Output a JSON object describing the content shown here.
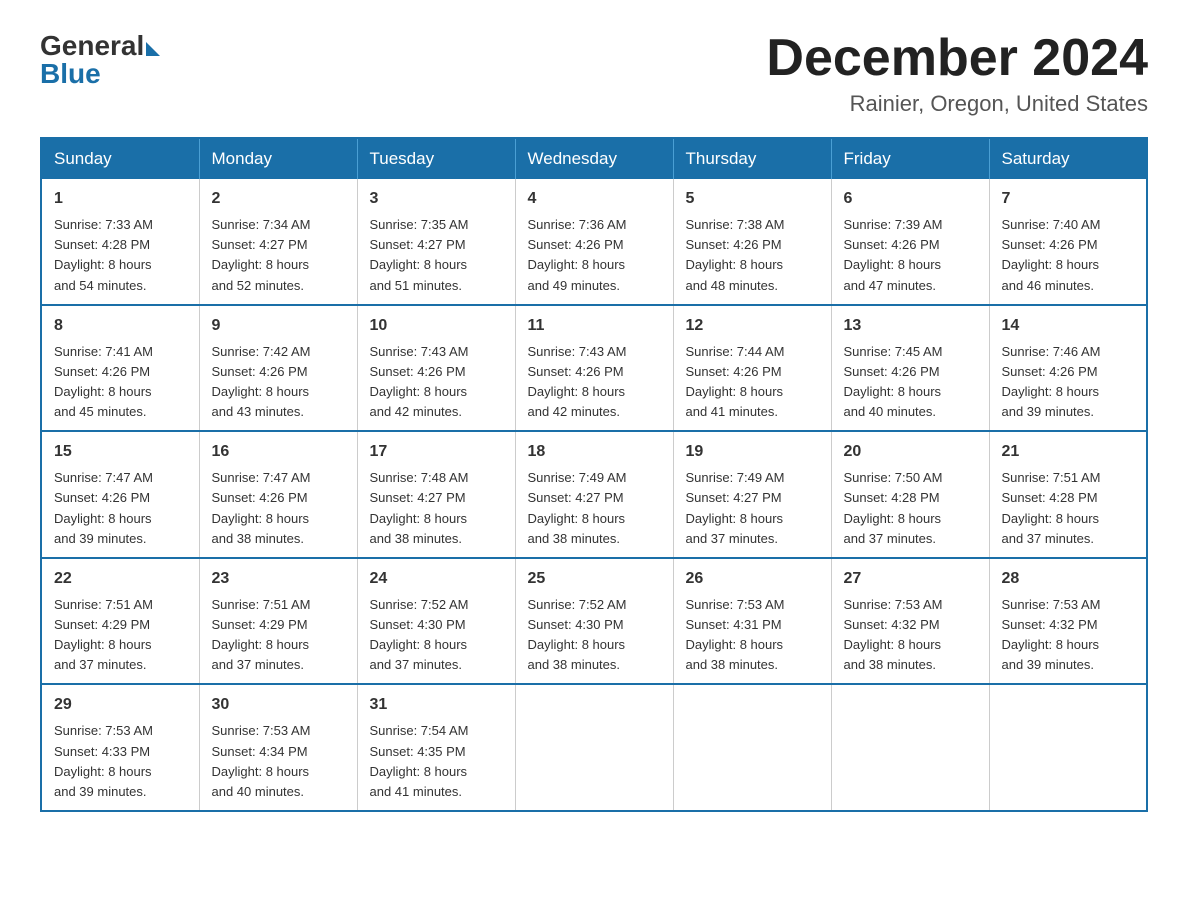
{
  "header": {
    "logo_general": "General",
    "logo_blue": "Blue",
    "month_title": "December 2024",
    "location": "Rainier, Oregon, United States"
  },
  "days_of_week": [
    "Sunday",
    "Monday",
    "Tuesday",
    "Wednesday",
    "Thursday",
    "Friday",
    "Saturday"
  ],
  "weeks": [
    [
      {
        "day": "1",
        "sunrise": "7:33 AM",
        "sunset": "4:28 PM",
        "daylight": "8 hours and 54 minutes."
      },
      {
        "day": "2",
        "sunrise": "7:34 AM",
        "sunset": "4:27 PM",
        "daylight": "8 hours and 52 minutes."
      },
      {
        "day": "3",
        "sunrise": "7:35 AM",
        "sunset": "4:27 PM",
        "daylight": "8 hours and 51 minutes."
      },
      {
        "day": "4",
        "sunrise": "7:36 AM",
        "sunset": "4:26 PM",
        "daylight": "8 hours and 49 minutes."
      },
      {
        "day": "5",
        "sunrise": "7:38 AM",
        "sunset": "4:26 PM",
        "daylight": "8 hours and 48 minutes."
      },
      {
        "day": "6",
        "sunrise": "7:39 AM",
        "sunset": "4:26 PM",
        "daylight": "8 hours and 47 minutes."
      },
      {
        "day": "7",
        "sunrise": "7:40 AM",
        "sunset": "4:26 PM",
        "daylight": "8 hours and 46 minutes."
      }
    ],
    [
      {
        "day": "8",
        "sunrise": "7:41 AM",
        "sunset": "4:26 PM",
        "daylight": "8 hours and 45 minutes."
      },
      {
        "day": "9",
        "sunrise": "7:42 AM",
        "sunset": "4:26 PM",
        "daylight": "8 hours and 43 minutes."
      },
      {
        "day": "10",
        "sunrise": "7:43 AM",
        "sunset": "4:26 PM",
        "daylight": "8 hours and 42 minutes."
      },
      {
        "day": "11",
        "sunrise": "7:43 AM",
        "sunset": "4:26 PM",
        "daylight": "8 hours and 42 minutes."
      },
      {
        "day": "12",
        "sunrise": "7:44 AM",
        "sunset": "4:26 PM",
        "daylight": "8 hours and 41 minutes."
      },
      {
        "day": "13",
        "sunrise": "7:45 AM",
        "sunset": "4:26 PM",
        "daylight": "8 hours and 40 minutes."
      },
      {
        "day": "14",
        "sunrise": "7:46 AM",
        "sunset": "4:26 PM",
        "daylight": "8 hours and 39 minutes."
      }
    ],
    [
      {
        "day": "15",
        "sunrise": "7:47 AM",
        "sunset": "4:26 PM",
        "daylight": "8 hours and 39 minutes."
      },
      {
        "day": "16",
        "sunrise": "7:47 AM",
        "sunset": "4:26 PM",
        "daylight": "8 hours and 38 minutes."
      },
      {
        "day": "17",
        "sunrise": "7:48 AM",
        "sunset": "4:27 PM",
        "daylight": "8 hours and 38 minutes."
      },
      {
        "day": "18",
        "sunrise": "7:49 AM",
        "sunset": "4:27 PM",
        "daylight": "8 hours and 38 minutes."
      },
      {
        "day": "19",
        "sunrise": "7:49 AM",
        "sunset": "4:27 PM",
        "daylight": "8 hours and 37 minutes."
      },
      {
        "day": "20",
        "sunrise": "7:50 AM",
        "sunset": "4:28 PM",
        "daylight": "8 hours and 37 minutes."
      },
      {
        "day": "21",
        "sunrise": "7:51 AM",
        "sunset": "4:28 PM",
        "daylight": "8 hours and 37 minutes."
      }
    ],
    [
      {
        "day": "22",
        "sunrise": "7:51 AM",
        "sunset": "4:29 PM",
        "daylight": "8 hours and 37 minutes."
      },
      {
        "day": "23",
        "sunrise": "7:51 AM",
        "sunset": "4:29 PM",
        "daylight": "8 hours and 37 minutes."
      },
      {
        "day": "24",
        "sunrise": "7:52 AM",
        "sunset": "4:30 PM",
        "daylight": "8 hours and 37 minutes."
      },
      {
        "day": "25",
        "sunrise": "7:52 AM",
        "sunset": "4:30 PM",
        "daylight": "8 hours and 38 minutes."
      },
      {
        "day": "26",
        "sunrise": "7:53 AM",
        "sunset": "4:31 PM",
        "daylight": "8 hours and 38 minutes."
      },
      {
        "day": "27",
        "sunrise": "7:53 AM",
        "sunset": "4:32 PM",
        "daylight": "8 hours and 38 minutes."
      },
      {
        "day": "28",
        "sunrise": "7:53 AM",
        "sunset": "4:32 PM",
        "daylight": "8 hours and 39 minutes."
      }
    ],
    [
      {
        "day": "29",
        "sunrise": "7:53 AM",
        "sunset": "4:33 PM",
        "daylight": "8 hours and 39 minutes."
      },
      {
        "day": "30",
        "sunrise": "7:53 AM",
        "sunset": "4:34 PM",
        "daylight": "8 hours and 40 minutes."
      },
      {
        "day": "31",
        "sunrise": "7:54 AM",
        "sunset": "4:35 PM",
        "daylight": "8 hours and 41 minutes."
      },
      null,
      null,
      null,
      null
    ]
  ],
  "labels": {
    "sunrise_prefix": "Sunrise: ",
    "sunset_prefix": "Sunset: ",
    "daylight_prefix": "Daylight: "
  }
}
